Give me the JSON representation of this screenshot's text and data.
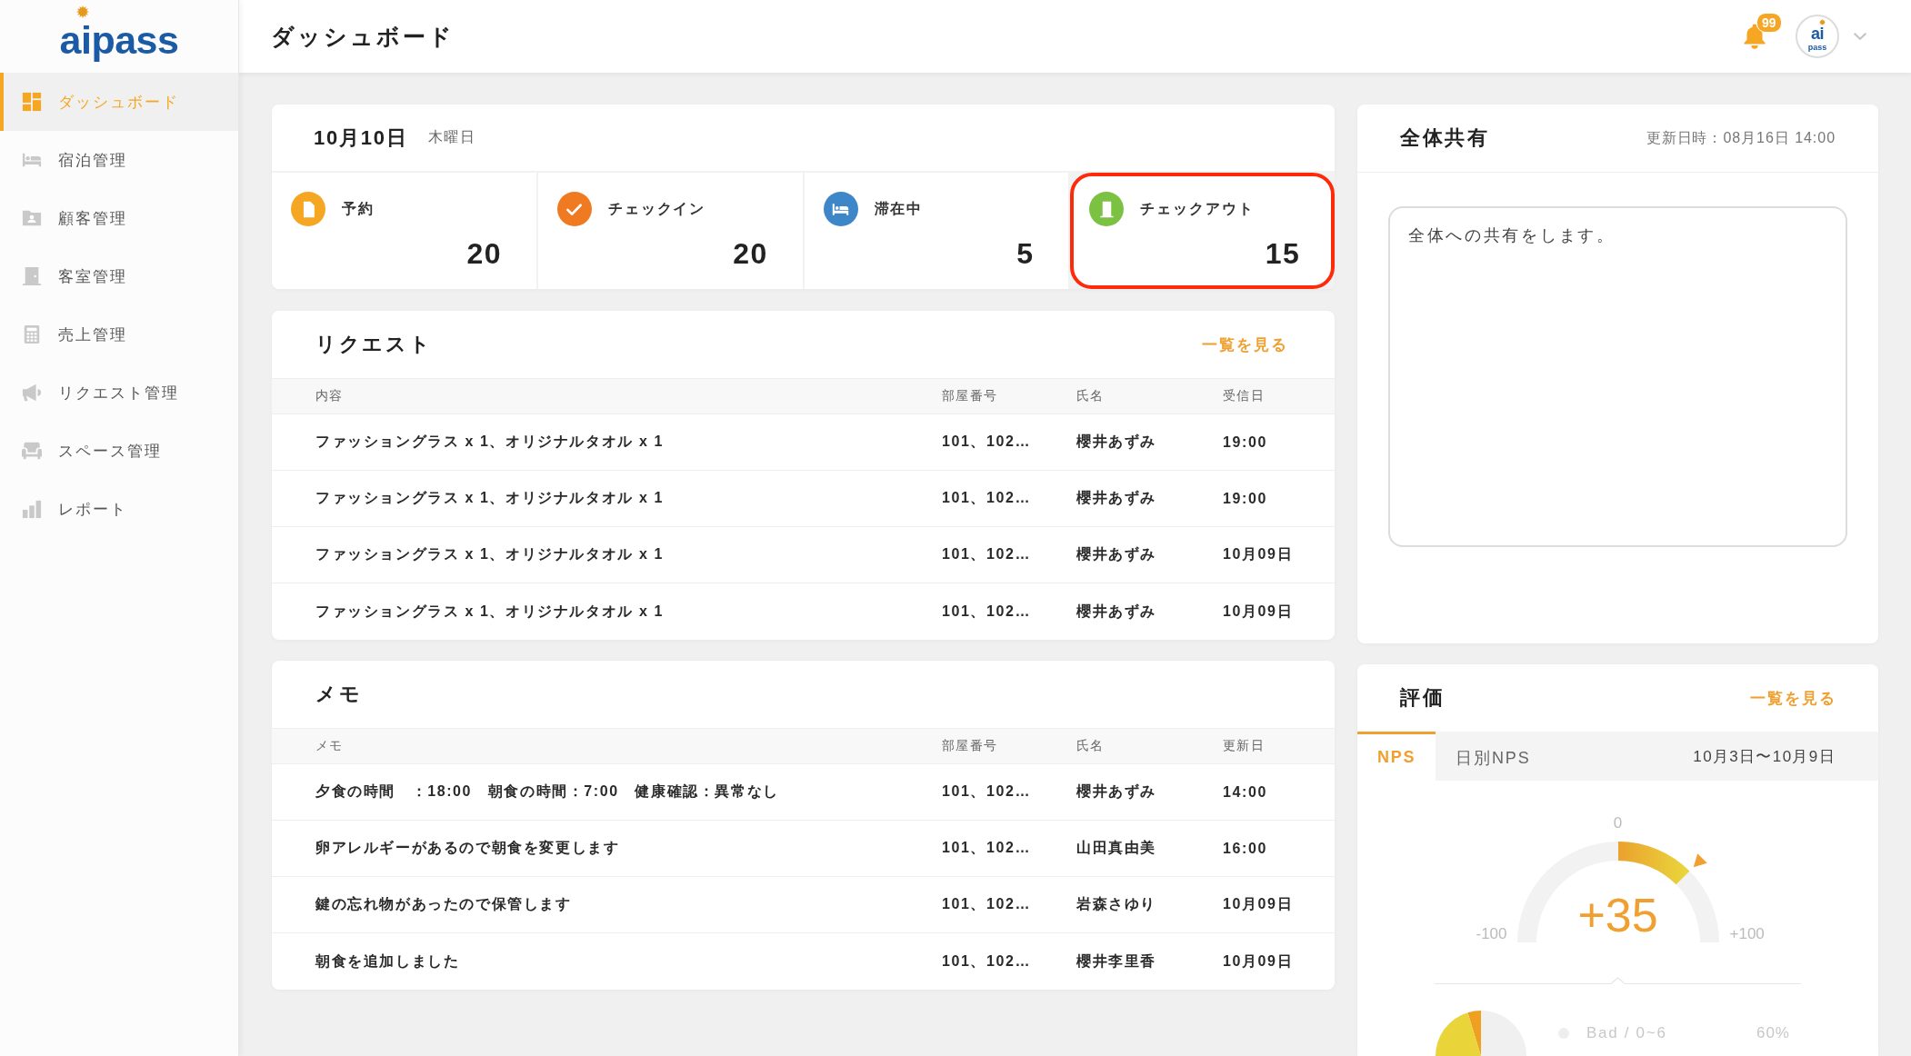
{
  "sidebar": {
    "logo": "aipass",
    "items": [
      {
        "label": "ダッシュボード",
        "selected": true
      },
      {
        "label": "宿泊管理",
        "selected": false
      },
      {
        "label": "顧客管理",
        "selected": false
      },
      {
        "label": "客室管理",
        "selected": false
      },
      {
        "label": "売上管理",
        "selected": false
      },
      {
        "label": "リクエスト管理",
        "selected": false
      },
      {
        "label": "スペース管理",
        "selected": false
      },
      {
        "label": "レポート",
        "selected": false
      }
    ]
  },
  "header": {
    "title": "ダッシュボード",
    "notification_count": "99",
    "avatar": {
      "logo_top": "ai",
      "logo_bottom": "pass"
    }
  },
  "date_panel": {
    "date": "10月10日",
    "weekday": "木曜日",
    "stats": [
      {
        "label": "予約",
        "value": "20",
        "color": "#f5a623",
        "highlighted": false
      },
      {
        "label": "チェックイン",
        "value": "20",
        "color": "#f07a22",
        "highlighted": false
      },
      {
        "label": "滞在中",
        "value": "5",
        "color": "#3d86c8",
        "highlighted": false
      },
      {
        "label": "チェックアウト",
        "value": "15",
        "color": "#7cc242",
        "highlighted": true
      }
    ]
  },
  "requests": {
    "title": "リクエスト",
    "link": "一覧を見る",
    "columns": [
      "内容",
      "部屋番号",
      "氏名",
      "受信日"
    ],
    "rows": [
      [
        "ファッショングラス x 1、オリジナルタオル x 1",
        "101、102…",
        "櫻井あずみ",
        "19:00"
      ],
      [
        "ファッショングラス x 1、オリジナルタオル x 1",
        "101、102…",
        "櫻井あずみ",
        "19:00"
      ],
      [
        "ファッショングラス x 1、オリジナルタオル x 1",
        "101、102…",
        "櫻井あずみ",
        "10月09日"
      ],
      [
        "ファッショングラス x 1、オリジナルタオル x 1",
        "101、102…",
        "櫻井あずみ",
        "10月09日"
      ]
    ]
  },
  "memos": {
    "title": "メモ",
    "columns": [
      "メモ",
      "部屋番号",
      "氏名",
      "更新日"
    ],
    "rows": [
      [
        "夕食の時間　：18:00　朝食の時間：7:00　健康確認：異常なし",
        "101、102…",
        "櫻井あずみ",
        "14:00"
      ],
      [
        "卵アレルギーがあるので朝食を変更します",
        "101、102…",
        "山田真由美",
        "16:00"
      ],
      [
        "鍵の忘れ物があったので保管します",
        "101、102…",
        "岩森さゆり",
        "10月09日"
      ],
      [
        "朝食を追加しました",
        "101、102…",
        "櫻井李里香",
        "10月09日"
      ]
    ]
  },
  "share": {
    "title": "全体共有",
    "updated": "更新日時：08月16日 14:00",
    "text": "全体への共有をします。"
  },
  "rating": {
    "title": "評価",
    "link": "一覧を見る",
    "tabs": [
      {
        "label": "NPS",
        "selected": true
      },
      {
        "label": "日別NPS",
        "selected": false
      }
    ],
    "period": "10月3日〜10月9日",
    "gauge": {
      "top_label": "0",
      "min_label": "-100",
      "max_label": "+100",
      "score": "+35",
      "level": 0.75
    },
    "legend": [
      {
        "label": "Bad / 0~6",
        "share": "60%",
        "color": "#eeeeee"
      }
    ]
  }
}
